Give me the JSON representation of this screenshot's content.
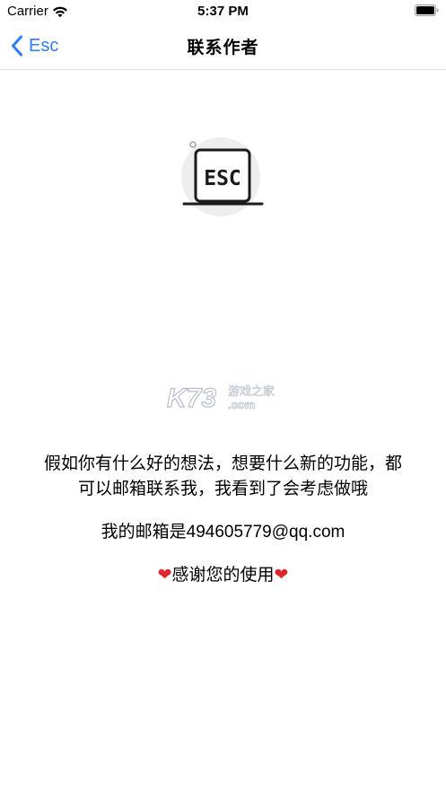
{
  "status_bar": {
    "carrier": "Carrier",
    "time": "5:37 PM"
  },
  "nav": {
    "back_label": "Esc",
    "title": "联系作者"
  },
  "logo": {
    "text": "ESC",
    "icon": "laptop-esc-icon"
  },
  "watermark": {
    "brand": "K73",
    "cn_text": "游戏之家",
    "domain": ".com"
  },
  "message": {
    "line1": "假如你有什么好的想法，想要什么新的功能，都",
    "line2": "可以邮箱联系我，我看到了会考虑做哦",
    "email_line": "我的邮箱是494605779@qq.com",
    "heart_left": "❤",
    "thanks": "感谢您的使用",
    "heart_right": "❤"
  },
  "colors": {
    "accent": "#2f7cf6",
    "heart": "#e0242b",
    "divider": "#e3e3e6"
  }
}
